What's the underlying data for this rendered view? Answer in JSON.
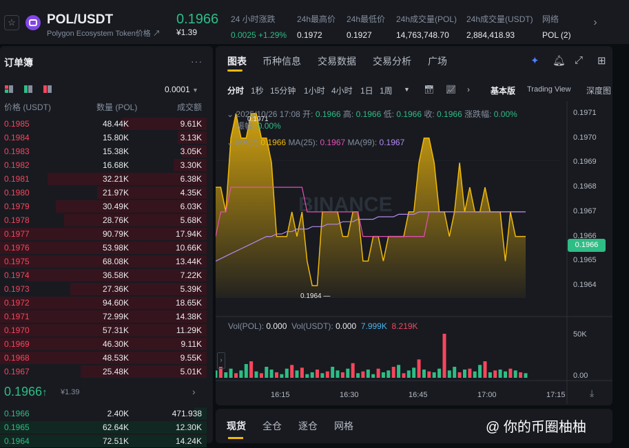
{
  "header": {
    "pair": "POL/USDT",
    "subtitle": "Polygon Ecosystem Token价格",
    "last_price": "0.1966",
    "last_price_fiat": "¥1.39",
    "stats": [
      {
        "label": "24 小时涨跌",
        "value": "0.0025 +1.29%",
        "color": "#2ebd85"
      },
      {
        "label": "24h最高价",
        "value": "0.1972"
      },
      {
        "label": "24h最低价",
        "value": "0.1927"
      },
      {
        "label": "24h成交量(POL)",
        "value": "14,763,748.70"
      },
      {
        "label": "24h成交量(USDT)",
        "value": "2,884,418.93"
      },
      {
        "label": "网络",
        "value": "POL (2)"
      }
    ]
  },
  "orderbook": {
    "title": "订单簿",
    "precision": "0.0001",
    "cols": [
      "价格 (USDT)",
      "数量 (POL)",
      "成交额"
    ],
    "asks": [
      {
        "p": "0.1985",
        "a": "48.44K",
        "t": "9.61K",
        "depth": 0.41
      },
      {
        "p": "0.1984",
        "a": "15.80K",
        "t": "3.13K",
        "depth": 0.14
      },
      {
        "p": "0.1983",
        "a": "15.38K",
        "t": "3.05K",
        "depth": 0.12
      },
      {
        "p": "0.1982",
        "a": "16.68K",
        "t": "3.30K",
        "depth": 0.16
      },
      {
        "p": "0.1981",
        "a": "32.21K",
        "t": "6.38K",
        "depth": 0.77
      },
      {
        "p": "0.1980",
        "a": "21.97K",
        "t": "4.35K",
        "depth": 0.53
      },
      {
        "p": "0.1979",
        "a": "30.49K",
        "t": "6.03K",
        "depth": 0.73
      },
      {
        "p": "0.1978",
        "a": "28.76K",
        "t": "5.68K",
        "depth": 0.69
      },
      {
        "p": "0.1977",
        "a": "90.79K",
        "t": "17.94K",
        "depth": 1.0
      },
      {
        "p": "0.1976",
        "a": "53.98K",
        "t": "10.66K",
        "depth": 1.0
      },
      {
        "p": "0.1975",
        "a": "68.08K",
        "t": "13.44K",
        "depth": 1.0
      },
      {
        "p": "0.1974",
        "a": "36.58K",
        "t": "7.22K",
        "depth": 0.88
      },
      {
        "p": "0.1973",
        "a": "27.36K",
        "t": "5.39K",
        "depth": 0.66
      },
      {
        "p": "0.1972",
        "a": "94.60K",
        "t": "18.65K",
        "depth": 1.0
      },
      {
        "p": "0.1971",
        "a": "72.99K",
        "t": "14.38K",
        "depth": 1.0
      },
      {
        "p": "0.1970",
        "a": "57.31K",
        "t": "11.29K",
        "depth": 1.0
      },
      {
        "p": "0.1969",
        "a": "46.30K",
        "t": "9.11K",
        "depth": 1.0
      },
      {
        "p": "0.1968",
        "a": "48.53K",
        "t": "9.55K",
        "depth": 1.0
      },
      {
        "p": "0.1967",
        "a": "25.48K",
        "t": "5.01K",
        "depth": 0.61
      }
    ],
    "mid_price": "0.1966",
    "mid_arrow": "↑",
    "mid_fiat": "¥1.39",
    "bids": [
      {
        "p": "0.1966",
        "a": "2.40K",
        "t": "471.938",
        "depth": 0.06
      },
      {
        "p": "0.1965",
        "a": "62.64K",
        "t": "12.30K",
        "depth": 1.0
      },
      {
        "p": "0.1964",
        "a": "72.51K",
        "t": "14.24K",
        "depth": 1.0
      }
    ]
  },
  "chart_panel": {
    "tabs": [
      "图表",
      "币种信息",
      "交易数据",
      "交易分析",
      "广场"
    ],
    "timeframes": [
      "分时",
      "1秒",
      "15分钟",
      "1小时",
      "4小时",
      "1日",
      "1周"
    ],
    "views": [
      "基本版",
      "Trading View",
      "深度图"
    ],
    "ohlc": {
      "time": "2025/10/26 17:08",
      "open_l": "开:",
      "open": "0.1966",
      "high_l": "高:",
      "high": "0.1966",
      "low_l": "低:",
      "low": "0.1966",
      "close_l": "收:",
      "close": "0.1966",
      "chg_l": "涨跌幅:",
      "chg": "0.00%",
      "amp_l": "振幅:",
      "amp": "0.00%"
    },
    "ma": {
      "ma7_l": "MA(7):",
      "ma7": "0.1966",
      "ma25_l": "MA(25):",
      "ma25": "0.1967",
      "ma99_l": "MA(99):",
      "ma99": "0.1967"
    },
    "vol": {
      "pol_l": "Vol(POL):",
      "pol": "0.000",
      "usdt_l": "Vol(USDT):",
      "usdt": "0.000",
      "v1": "7.999K",
      "v2": "8.219K"
    },
    "high_mark": "0.1971",
    "low_mark": "0.1964",
    "current_tag": "0.1966",
    "watermark": "BINANCE",
    "colors": {
      "price": "#f0b90b",
      "ma25": "#e84fb8",
      "ma99": "#b38af0",
      "up": "#2ebd85",
      "down": "#f6465d"
    }
  },
  "chart_data": {
    "type": "area",
    "title": "",
    "xlabel": "",
    "ylabel": "",
    "ylim": [
      0.19635,
      0.19715
    ],
    "x_ticks": [
      "16:15",
      "16:30",
      "16:45",
      "17:00",
      "17:15"
    ],
    "y_ticks": [
      "0.1971",
      "0.1970",
      "0.1969",
      "0.1968",
      "0.1967",
      "0.1966",
      "0.1965",
      "0.1964"
    ],
    "vol_ticks": [
      "50K",
      "0.00"
    ],
    "series": [
      {
        "values": [
          0.1968,
          0.1968,
          0.1967,
          0.197,
          0.1971,
          0.197,
          0.197,
          0.1971,
          0.1971,
          0.197,
          0.197,
          0.1969,
          0.1966,
          0.1966,
          0.1966,
          0.1967,
          0.1966,
          0.1967,
          0.1965,
          0.1964,
          0.1964,
          0.1967,
          0.1967,
          0.1967,
          0.1967,
          0.1966,
          0.1966,
          0.1967,
          0.1967,
          0.1965,
          0.1965,
          0.1966,
          0.1966,
          0.1965,
          0.1966,
          0.1966,
          0.1966,
          0.1966,
          0.1967,
          0.1967,
          0.1969,
          0.197,
          0.197,
          0.1969,
          0.1967,
          0.1967,
          0.1966,
          0.1967,
          0.1969,
          0.1967,
          0.1968,
          0.1967,
          0.1967,
          0.1968,
          0.1967,
          0.1967,
          0.1967,
          0.1965,
          0.1967,
          0.1966,
          0.1966,
          0.1966
        ]
      },
      {
        "name": "MA(25)",
        "values": [
          0.1966,
          0.1967,
          0.1967,
          0.1968,
          0.1968,
          0.1968,
          0.1968,
          0.1968,
          0.1968,
          0.1968,
          0.1968,
          0.1968,
          0.1968,
          0.1968,
          0.1968,
          0.1968,
          0.1968,
          0.1968,
          0.1967,
          0.1967,
          0.1967,
          0.1967,
          0.1967,
          0.1967,
          0.1967,
          0.1967,
          0.1967,
          0.1967,
          0.1967,
          0.1966,
          0.1966,
          0.1966,
          0.1966,
          0.1966,
          0.1966,
          0.1966,
          0.1966,
          0.1966,
          0.1966,
          0.1966,
          0.1966,
          0.1966,
          0.1967,
          0.1967,
          0.1967,
          0.1967,
          0.1967,
          0.1967,
          0.1967,
          0.1967,
          0.1967,
          0.1967,
          0.1967,
          0.1967,
          0.1967,
          0.1967,
          0.1967,
          0.1967,
          0.1967,
          0.1967,
          0.1967,
          0.1967
        ]
      },
      {
        "name": "MA(99)",
        "values": [
          0.1965,
          0.19651,
          0.19652,
          0.19653,
          0.19654,
          0.19655,
          0.19656,
          0.19657,
          0.19658,
          0.19659,
          0.1966,
          0.1966,
          0.19661,
          0.19661,
          0.19662,
          0.19662,
          0.19663,
          0.19663,
          0.19663,
          0.19664,
          0.19664,
          0.19664,
          0.19665,
          0.19665,
          0.19665,
          0.19666,
          0.19666,
          0.19666,
          0.19667,
          0.19667,
          0.19667,
          0.19667,
          0.19668,
          0.19668,
          0.19668,
          0.19668,
          0.19669,
          0.19669,
          0.19669,
          0.19669,
          0.1967,
          0.1967,
          0.1967,
          0.1967,
          0.1967,
          0.1967,
          0.1967,
          0.1967,
          0.1967,
          0.1967,
          0.1967,
          0.1967,
          0.1967,
          0.1967,
          0.1967,
          0.1967,
          0.1967,
          0.1967,
          0.1967,
          0.1967,
          0.1967,
          0.1967
        ]
      }
    ],
    "volume": [
      8,
      12,
      6,
      10,
      5,
      8,
      15,
      18,
      7,
      5,
      12,
      9,
      6,
      4,
      10,
      14,
      8,
      11,
      4,
      6,
      9,
      5,
      7,
      12,
      8,
      6,
      10,
      16,
      5,
      7,
      9,
      4,
      10,
      6,
      8,
      12,
      14,
      5,
      8,
      11,
      20,
      9,
      7,
      6,
      10,
      48,
      8,
      12,
      6,
      9,
      10,
      7,
      14,
      18,
      6,
      8,
      9,
      7,
      10,
      8,
      6,
      5
    ],
    "volume_up": [
      1,
      0,
      1,
      1,
      0,
      1,
      1,
      0,
      1,
      0,
      1,
      1,
      0,
      1,
      1,
      0,
      1,
      0,
      1,
      1,
      0,
      1,
      0,
      1,
      1,
      0,
      1,
      0,
      1,
      0,
      1,
      1,
      0,
      1,
      1,
      0,
      1,
      0,
      1,
      1,
      0,
      1,
      0,
      1,
      1,
      0,
      1,
      1,
      0,
      1,
      0,
      1,
      1,
      0,
      1,
      0,
      1,
      1,
      0,
      1,
      0,
      1
    ]
  },
  "bottom_tabs": [
    "现货",
    "全仓",
    "逐仓",
    "网格"
  ],
  "watermark_text": "@ 你的币圈柚柚"
}
